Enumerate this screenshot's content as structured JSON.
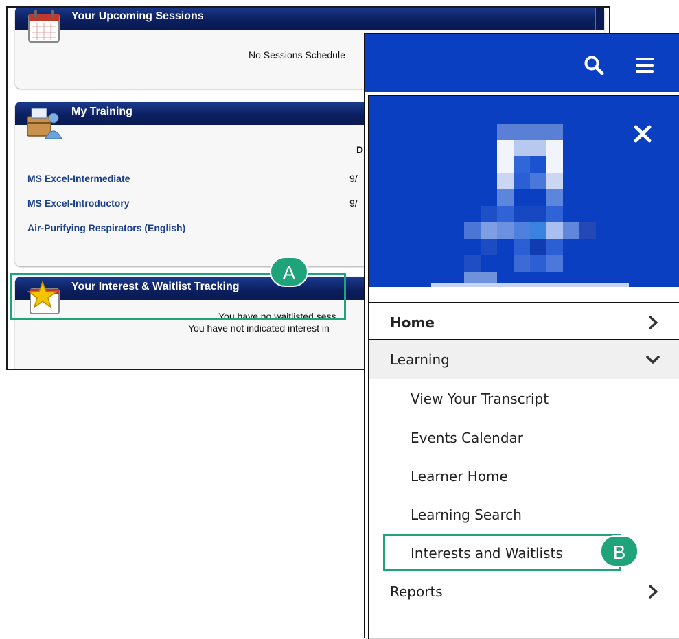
{
  "legacy": {
    "upcoming": {
      "title": "Your Upcoming Sessions",
      "empty_message": "No Sessions Schedule"
    },
    "my_training": {
      "title": "My Training",
      "column_header": "D",
      "items": [
        {
          "name": "MS Excel-Intermediate",
          "date": "9/"
        },
        {
          "name": "MS Excel-Introductory",
          "date": "9/"
        },
        {
          "name": "Air-Purifying Respirators (English)",
          "date": ""
        }
      ]
    },
    "interest": {
      "title": "Your Interest & Waitlist Tracking",
      "line1": "You have no waitlisted sess",
      "line2": "You have not indicated interest in"
    }
  },
  "callouts": {
    "a_label": "A",
    "b_label": "B",
    "color": "#1fa37a"
  },
  "mobile": {
    "brand_color": "#0a3fc2",
    "icons": {
      "search": "search-icon",
      "menu": "hamburger-menu-icon",
      "close": "close-icon"
    },
    "nav": {
      "home": "Home",
      "learning": "Learning",
      "learning_items": [
        "View Your Transcript",
        "Events Calendar",
        "Learner Home",
        "Learning Search",
        "Interests and Waitlists"
      ],
      "reports": "Reports"
    }
  }
}
